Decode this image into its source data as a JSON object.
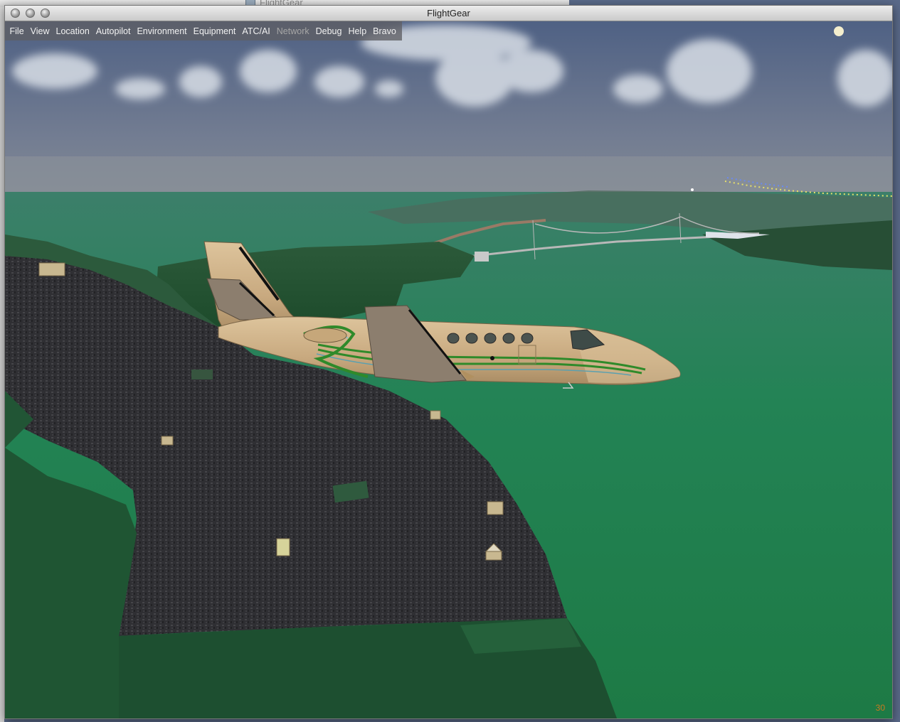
{
  "background_window": {
    "title": "FlightGear"
  },
  "window": {
    "title": "FlightGear"
  },
  "menu": {
    "items": [
      {
        "label": "File",
        "enabled": true
      },
      {
        "label": "View",
        "enabled": true
      },
      {
        "label": "Location",
        "enabled": true
      },
      {
        "label": "Autopilot",
        "enabled": true
      },
      {
        "label": "Environment",
        "enabled": true
      },
      {
        "label": "Equipment",
        "enabled": true
      },
      {
        "label": "ATC/AI",
        "enabled": true
      },
      {
        "label": "Network",
        "enabled": false
      },
      {
        "label": "Debug",
        "enabled": true
      },
      {
        "label": "Help",
        "enabled": true
      },
      {
        "label": "Bravo",
        "enabled": true
      }
    ]
  },
  "hud": {
    "frame_rate": "30"
  },
  "colors": {
    "water": "#1f7a4e",
    "city": "#3b3b40",
    "aircraft_body": "#cdb089",
    "stripe_green": "#2f8a2a",
    "fps_text": "#c87820"
  }
}
